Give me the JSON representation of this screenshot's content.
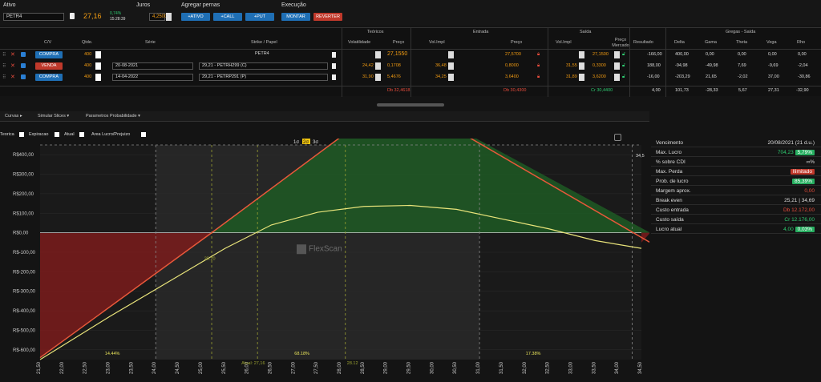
{
  "top": {
    "ativo_label": "Ativo",
    "ativo_value": "PETR4",
    "price": "27,16",
    "change": "0,74%",
    "time": "15:28:39",
    "juros_label": "Juros",
    "juros_value": "4,2500",
    "pernas_label": "Agregar pernas",
    "btn_ativo": "+ATIVO",
    "btn_call": "+CALL",
    "btn_put": "+PUT",
    "exec_label": "Execução",
    "btn_montar": "MONTAR",
    "btn_reverter": "REVERTER"
  },
  "headers": {
    "teoricos": "Teóricos",
    "entrada": "Entrada",
    "saida": "Saída",
    "gregas": "Gregas - Saída",
    "cv": "C/V",
    "qtde": "Qtde.",
    "serie": "Série",
    "strike": "Strike / Papel",
    "volat": "Volatilidade",
    "preco": "Preço",
    "volimpl": "Vol.Impl",
    "preco2": "Preço",
    "volimpl2": "Vol.Impl",
    "preco_merc": "Preço Mercado",
    "resultado": "Resultado",
    "delta": "Delta",
    "gama": "Gama",
    "theta": "Theta",
    "vega": "Vega",
    "rho": "Rho"
  },
  "rows": [
    {
      "side": "COMPRA",
      "qty": "400",
      "serie": "",
      "strike": "PETR4",
      "vol": "",
      "teo_preco": "27,1550",
      "ent_vol": "",
      "ent_preco": "27,5700",
      "sai_vol": "",
      "sai_preco": "27,1500",
      "resultado": "-166,00",
      "delta": "400,00",
      "gama": "0,00",
      "theta": "0,00",
      "vega": "0,00",
      "rho": "0,00"
    },
    {
      "side": "VENDA",
      "qty": "400",
      "serie": "20-08-2021",
      "strike": "29,21 - PETRH299 (C)",
      "vol": "24,42",
      "teo_preco": "0,1708",
      "ent_vol": "36,48",
      "ent_preco": "0,8000",
      "sai_vol": "31,55",
      "sai_preco": "0,3300",
      "resultado": "188,00",
      "delta": "-94,98",
      "gama": "-49,98",
      "theta": "7,69",
      "vega": "-9,69",
      "rho": "-2,04"
    },
    {
      "side": "COMPRA",
      "qty": "400",
      "serie": "14-04-2022",
      "strike": "29,21 - PETRP291 (P)",
      "vol": "31,90",
      "teo_preco": "5,4676",
      "ent_vol": "34,25",
      "ent_preco": "3,6400",
      "sai_vol": "31,89",
      "sai_preco": "3,6200",
      "resultado": "-16,00",
      "delta": "-203,29",
      "gama": "21,65",
      "theta": "-2,02",
      "vega": "37,00",
      "rho": "-30,86"
    }
  ],
  "totals": {
    "teo": "Db 32,4618",
    "ent": "Db 30,4300",
    "sai": "Cr 30,4400",
    "resultado": "4,00",
    "delta": "101,73",
    "gama": "-28,33",
    "theta": "5,67",
    "vega": "27,31",
    "rho": "-32,90"
  },
  "tabs": {
    "curvas": "Curvas ▸",
    "simular": "Simular Slices ▾",
    "param": "Parametros Probabilidade ▾"
  },
  "legend": {
    "teorica": "Teorica",
    "expiracao": "Expiracao",
    "atual": "Atual",
    "area": "Area Lucro/Prejuizo"
  },
  "sigma": [
    "1σ",
    "2σ",
    "3σ"
  ],
  "watermark": "FlexScan",
  "summary": [
    {
      "k": "Vencimento",
      "v": "20/08/2021 (21 d.u.)",
      "style": "wht"
    },
    {
      "k": "Max. Lucro",
      "v": "704,23",
      "pill": "5,79%",
      "style": "grn",
      "pillc": "#27ae60"
    },
    {
      "k": "% sobre CDI",
      "v": "∞%",
      "style": "wht"
    },
    {
      "k": "Max. Perda",
      "v": "",
      "pill": "Ilimitado",
      "style": "wht",
      "pillc": "#c0392b"
    },
    {
      "k": "Prob. de lucro",
      "v": "",
      "pill": "85,39%",
      "style": "wht",
      "pillc": "#27ae60"
    },
    {
      "k": "Margem aprox.",
      "v": "0,00",
      "style": "redt"
    },
    {
      "k": "Break even",
      "v": "25,21 | 34,69",
      "style": "wht"
    },
    {
      "k": "Custo entrada",
      "v": "Db 12.172,00",
      "style": "redt"
    },
    {
      "k": "Custo saída",
      "v": "Cr 12.176,00",
      "style": "grn"
    },
    {
      "k": "Lucro atual",
      "v": "4,00",
      "pill": "0,03%",
      "style": "grn",
      "pillc": "#27ae60"
    }
  ],
  "chart_data": {
    "type": "line",
    "ylabels": [
      "R$400,00",
      "R$300,00",
      "R$200,00",
      "R$100,00",
      "R$0,00",
      "R$-100,00",
      "R$-200,00",
      "R$-300,00",
      "R$-400,00",
      "R$-500,00",
      "R$-600,00"
    ],
    "x": [
      "21,50",
      "22,00",
      "22,50",
      "23,00",
      "23,50",
      "24,00",
      "24,50",
      "25,00",
      "25,50",
      "26,00",
      "26,50",
      "27,00",
      "27,50",
      "28,00",
      "28,50",
      "29,00",
      "29,50",
      "30,00",
      "30,50",
      "31,00",
      "31,50",
      "32,00",
      "32,50",
      "33,00",
      "33,50",
      "34,00",
      "34,50"
    ],
    "ylim": [
      -650,
      450
    ],
    "expiracao": {
      "x": [
        21.5,
        25.21,
        29.21,
        34.69
      ],
      "y": [
        -640,
        0,
        704,
        -50
      ]
    },
    "atual": {
      "x": [
        21.5,
        23,
        24.5,
        25.5,
        26.5,
        27.5,
        28.5,
        29.5,
        30.5,
        31.5,
        32.5,
        33.5,
        34.5
      ],
      "y": [
        -650,
        -430,
        -220,
        -80,
        40,
        105,
        135,
        140,
        120,
        70,
        20,
        -40,
        -80
      ]
    },
    "annotations": {
      "pct_left": "14.44%",
      "pct_mid": "68.18%",
      "pct_right": "17.38%",
      "be_left": "25.20",
      "be_right": "34,5",
      "current": "28.12",
      "spot": "Atual: 27,16"
    }
  }
}
